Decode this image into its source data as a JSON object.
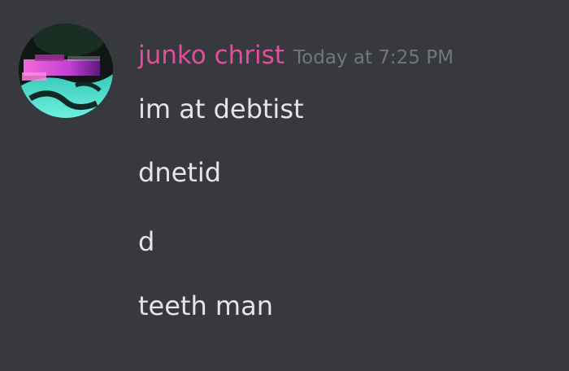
{
  "author": {
    "name": "junko christ",
    "timestamp": "Today at 7:25 PM",
    "name_color": "#e44c9c"
  },
  "messages": [
    "im at debtist",
    "dnetid",
    "d",
    "teeth man"
  ],
  "theme": {
    "background": "#37393f",
    "text_color": "#e3e5e8",
    "timestamp_color": "#72767d"
  }
}
